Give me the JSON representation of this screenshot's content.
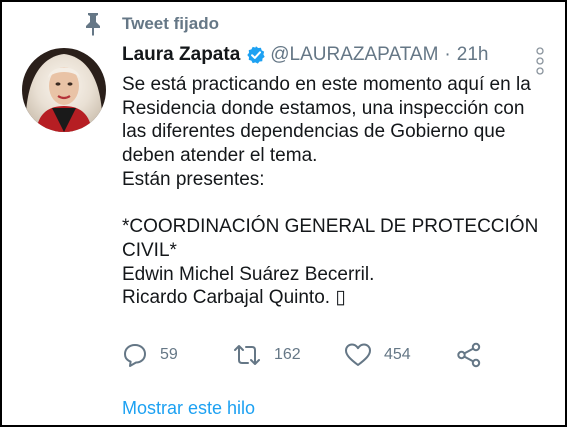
{
  "tweet": {
    "pinned_label": "Tweet fijado",
    "author_name": "Laura Zapata",
    "handle": "@LAURAZAPATAM",
    "separator": "·",
    "time": "21h",
    "text_lines": [
      "Se está practicando en este momento aquí en la",
      "Residencia donde estamos, una inspección con",
      "las diferentes dependencias de Gobierno que",
      "deben atender el tema.",
      "Están presentes:",
      "",
      "*COORDINACIÓN GENERAL DE PROTECCIÓN",
      "CIVIL*",
      "Edwin Michel Suárez Becerril.",
      "Ricardo Carbajal Quinto. ▯"
    ],
    "reply_count": "59",
    "retweet_count": "162",
    "like_count": "454",
    "show_thread_label": "Mostrar este hilo"
  },
  "icons": {
    "pin": "pin-icon",
    "verified": "verified-badge-icon",
    "more": "more-vertical-icon",
    "reply": "reply-icon",
    "retweet": "retweet-icon",
    "like": "heart-icon",
    "share": "share-icon"
  },
  "colors": {
    "text": "#14171a",
    "secondary": "#657786",
    "accent": "#1da1f2"
  }
}
